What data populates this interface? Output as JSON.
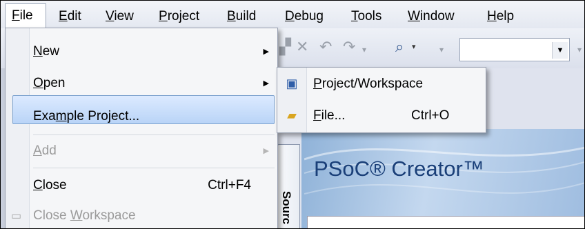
{
  "menubar": {
    "items": [
      {
        "pre": "",
        "acc": "F",
        "post": "ile"
      },
      {
        "pre": "",
        "acc": "E",
        "post": "dit"
      },
      {
        "pre": "",
        "acc": "V",
        "post": "iew"
      },
      {
        "pre": "",
        "acc": "P",
        "post": "roject"
      },
      {
        "pre": "",
        "acc": "B",
        "post": "uild"
      },
      {
        "pre": "",
        "acc": "D",
        "post": "ebug"
      },
      {
        "pre": "",
        "acc": "T",
        "post": "ools"
      },
      {
        "pre": "",
        "acc": "W",
        "post": "indow"
      },
      {
        "pre": "",
        "acc": "H",
        "post": "elp"
      }
    ]
  },
  "file_menu": {
    "new": {
      "pre": "",
      "acc": "N",
      "post": "ew"
    },
    "open": {
      "pre": "",
      "acc": "O",
      "post": "pen"
    },
    "example": {
      "pre": "Exa",
      "acc": "m",
      "post": "ple Project..."
    },
    "add": {
      "pre": "",
      "acc": "A",
      "post": "dd"
    },
    "close": {
      "pre": "",
      "acc": "C",
      "post": "lose",
      "shortcut": "Ctrl+F4"
    },
    "close_ws": {
      "pre": "Close ",
      "acc": "W",
      "post": "orkspace"
    }
  },
  "open_submenu": {
    "project": {
      "pre": "",
      "acc": "P",
      "post": "roject/Workspace"
    },
    "file": {
      "pre": "",
      "acc": "F",
      "post": "ile...",
      "shortcut": "Ctrl+O"
    }
  },
  "start_page": {
    "logo": "PSoC® Creator™"
  },
  "doc_tab": {
    "label": "Sourc"
  },
  "colors": {
    "highlight": "#b9d4f7",
    "logo": "#1a3f78"
  }
}
